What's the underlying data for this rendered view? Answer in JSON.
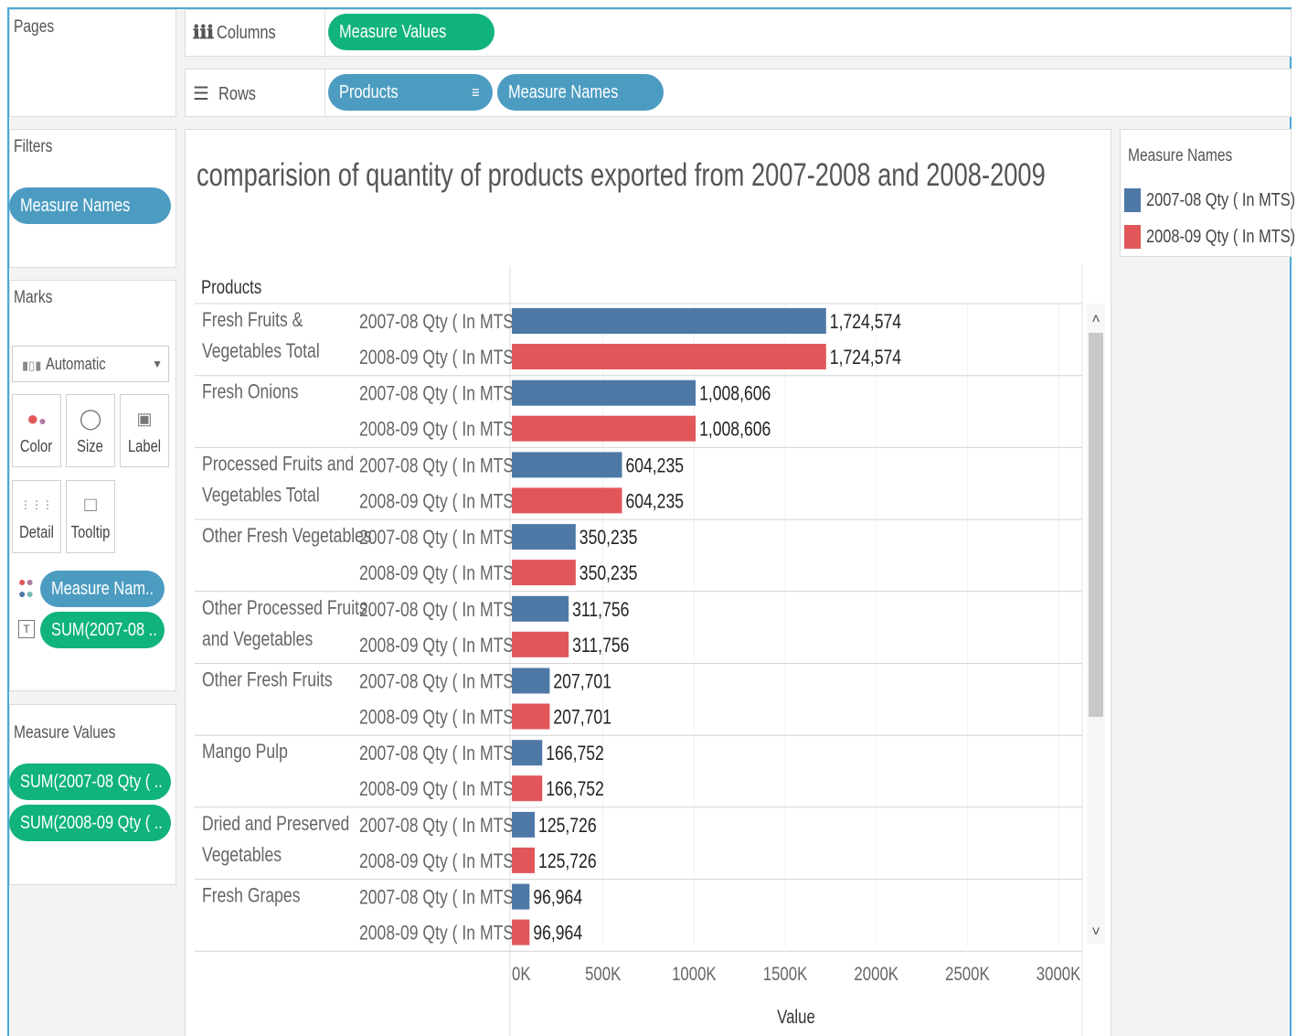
{
  "panels": {
    "pages_title": "Pages",
    "filters_title": "Filters",
    "marks_title": "Marks",
    "measure_values_title": "Measure Values"
  },
  "shelves": {
    "columns_label": "Columns",
    "rows_label": "Rows",
    "columns_pills": [
      "Measure Values"
    ],
    "rows_pills": [
      "Products",
      "Measure Names"
    ]
  },
  "filters": {
    "pills": [
      "Measure Names"
    ]
  },
  "marks": {
    "type_label": "Automatic",
    "buttons": [
      "Color",
      "Size",
      "Label",
      "Detail",
      "Tooltip"
    ],
    "pills": [
      "Measure Nam..",
      "SUM(2007-08 .."
    ]
  },
  "measure_values": {
    "pills": [
      "SUM(2007-08 Qty ( ..",
      "SUM(2008-09 Qty ( .."
    ]
  },
  "legend": {
    "title": "Measure Names",
    "items": [
      {
        "label": "2007-08 Qty ( In MTS)",
        "color": "#4e79a7"
      },
      {
        "label": "2008-09 Qty ( In MTS)",
        "color": "#e15759"
      }
    ]
  },
  "chart_data": {
    "type": "bar",
    "orientation": "horizontal",
    "title": "comparision of quantity of products exported  from 2007-2008 and 2008-2009",
    "row_header": "Products",
    "xlabel": "Value",
    "xlim": [
      0,
      3000000
    ],
    "x_ticks": [
      "0K",
      "500K",
      "1000K",
      "1500K",
      "2000K",
      "2500K",
      "3000K"
    ],
    "measure_labels": [
      "2007-08 Qty ( In MTS)",
      "2008-09 Qty ( In MTS)"
    ],
    "categories": [
      {
        "name": [
          "Fresh Fruits &",
          "Vegetables Total"
        ],
        "values": [
          1724574,
          1724574
        ],
        "labels": [
          "1,724,574",
          "1,724,574"
        ]
      },
      {
        "name": [
          "Fresh Onions"
        ],
        "values": [
          1008606,
          1008606
        ],
        "labels": [
          "1,008,606",
          "1,008,606"
        ]
      },
      {
        "name": [
          "Processed Fruits and",
          "Vegetables Total"
        ],
        "values": [
          604235,
          604235
        ],
        "labels": [
          "604,235",
          "604,235"
        ]
      },
      {
        "name": [
          "Other Fresh Vegetables"
        ],
        "values": [
          350235,
          350235
        ],
        "labels": [
          "350,235",
          "350,235"
        ]
      },
      {
        "name": [
          "Other Processed Fruits",
          "and Vegetables"
        ],
        "values": [
          311756,
          311756
        ],
        "labels": [
          "311,756",
          "311,756"
        ]
      },
      {
        "name": [
          "Other Fresh Fruits"
        ],
        "values": [
          207701,
          207701
        ],
        "labels": [
          "207,701",
          "207,701"
        ]
      },
      {
        "name": [
          "Mango Pulp"
        ],
        "values": [
          166752,
          166752
        ],
        "labels": [
          "166,752",
          "166,752"
        ]
      },
      {
        "name": [
          "Dried and Preserved",
          "Vegetables"
        ],
        "values": [
          125726,
          125726
        ],
        "labels": [
          "125,726",
          "125,726"
        ]
      },
      {
        "name": [
          "Fresh Grapes"
        ],
        "values": [
          96964,
          96964
        ],
        "labels": [
          "96,964",
          "96,964"
        ]
      }
    ],
    "series": [
      {
        "name": "2007-08 Qty ( In MTS)",
        "color": "#4e79a7"
      },
      {
        "name": "2008-09 Qty ( In MTS)",
        "color": "#e15759"
      }
    ]
  }
}
